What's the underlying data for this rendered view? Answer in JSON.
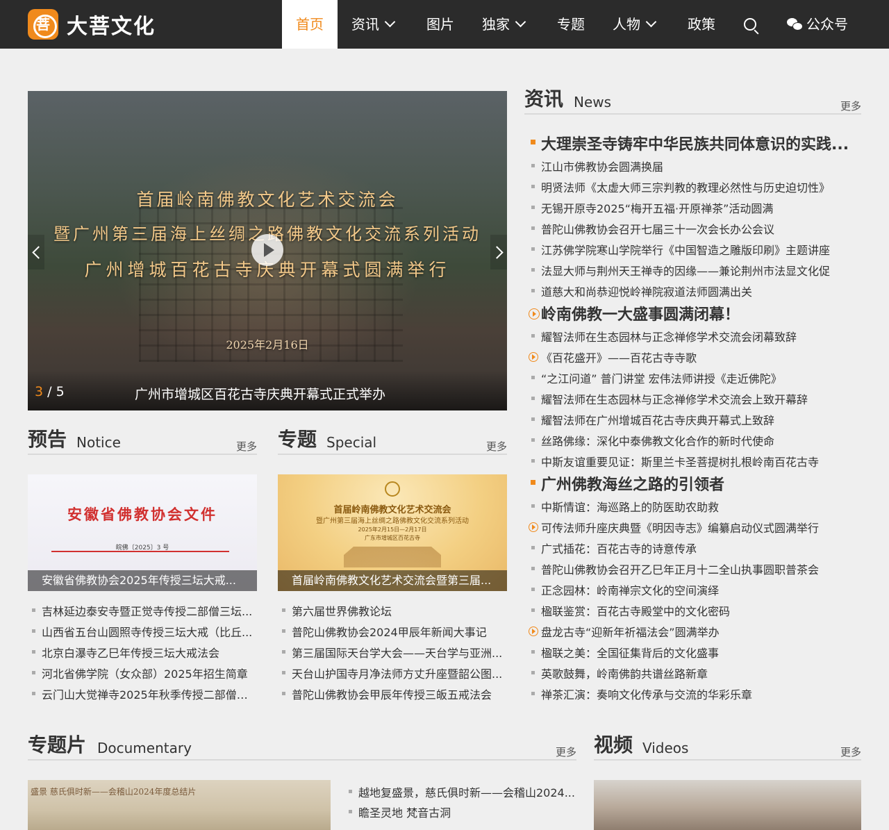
{
  "brand": {
    "logo_glyph": "菩",
    "name": "大菩文化",
    "accent": "#f08a1c"
  },
  "nav": {
    "home": "首页",
    "news": "资讯",
    "photos": "图片",
    "exclusive": "独家",
    "topics": "专题",
    "people": "人物",
    "policy": "政策",
    "wechat": "公众号"
  },
  "slider": {
    "line1": "首届岭南佛教文化艺术交流会",
    "line2": "暨广州第三届海上丝绸之路佛教文化交流系列活动",
    "line3": "广州增城百花古寺庆典开幕式圆满举行",
    "date": "2025年2月16日",
    "current": "3",
    "separator": " / ",
    "total": "5",
    "caption": "广州市增城区百花古寺庆典开幕式正式举办"
  },
  "news": {
    "title_zh": "资讯",
    "title_en": "News",
    "more": "更多",
    "items": [
      "大理崇圣寺铸牢中华民族共同体意识的实践...",
      "江山市佛教协会圆满换届",
      "明贤法师《太虚大师三宗判教的教理必然性与历史迫切性》",
      "无锡开原寺2025“梅开五福·开原禅茶”活动圆满",
      "普陀山佛教协会召开七届三十一次会长办公会议",
      "江苏佛学院寒山学院举行《中国智造之雕版印刷》主题讲座",
      "法显大师与荆州天王禅寺的因缘——兼论荆州市法显文化促",
      "道慈大和尚恭迎悦岭禅院寂道法师圆满出关",
      "岭南佛教一大盛事圆满闭幕！",
      "耀智法师在生态园林与正念禅修学术交流会闭幕致辞",
      "《百花盛开》——百花古寺寺歌",
      "“之江问道” 普门讲堂 宏伟法师讲授《走近佛陀》",
      "耀智法师在生态园林与正念禅修学术交流会上致开幕辞",
      "耀智法师在广州增城百花古寺庆典开幕式上致辞",
      "丝路佛缘：深化中泰佛教文化合作的新时代使命",
      "中斯友谊重要见证：斯里兰卡圣菩提树扎根岭南百花古寺",
      "广州佛教海丝之路的引领者",
      "中斯情谊：海巡路上的防医助农助救",
      "可传法师升座庆典暨《明因寺志》编纂启动仪式圆满举行",
      "广式插花：百花古寺的诗意传承",
      "普陀山佛教协会召开乙巳年正月十二全山执事圆职普茶会",
      "正念园林：岭南禅宗文化的空间演绎",
      "楹联鉴赏：百花古寺殿堂中的文化密码",
      "盘龙古寺“迎新年祈福法会”圆满举办",
      "楹联之美：全国征集背后的文化盛事",
      "英歌鼓舞，岭南佛韵共谱丝路新章",
      "禅茶汇演：奏响文化传承与交流的华彩乐章"
    ]
  },
  "notice": {
    "title_zh": "预告",
    "title_en": "Notice",
    "more": "更多",
    "card_doc_title": "安徽省佛教协会文件",
    "card_doc_no": "皖佛〔2025〕3 号",
    "card_caption": "安徽省佛教协会2025年传授三坛大戒...",
    "items": [
      "吉林延边泰安寺暨正觉寺传授二部僧三坛...",
      "山西省五台山圆照寺传授三坛大戒（比丘...",
      "北京白瀑寺乙巳年传授三坛大戒法会",
      "河北省佛学院（女众部）2025年招生简章",
      "云门山大觉禅寺2025年秋季传授二部僧三..."
    ]
  },
  "special": {
    "title_zh": "专题",
    "title_en": "Special",
    "more": "更多",
    "card_line1": "首届岭南佛教文化艺术交流会",
    "card_line2": "暨广州第三届海上丝绸之路佛教文化交流系列活动",
    "card_line3": "2025年2月15日—2月17日",
    "card_line4": "广东市增城区百花古寺",
    "card_caption": "首届岭南佛教文化艺术交流会暨第三届...",
    "items": [
      "第六届世界佛教论坛",
      "普陀山佛教协会2024甲辰年新闻大事记",
      "第三届国际天台学大会——天台学与亚洲...",
      "天台山护国寺月净法师方丈升座暨韶公图...",
      "普陀山佛教协会甲辰年传授三皈五戒法会"
    ]
  },
  "documentary": {
    "title_zh": "专题片",
    "title_en": "Documentary",
    "more": "更多",
    "image_title": "盛景 慈氏俱时新——会稽山2024年度总结片",
    "items": [
      "越地复盛景，慈氏俱时新——会稽山2024...",
      "瞻圣灵地 梵音古洞"
    ]
  },
  "videos": {
    "title_zh": "视频",
    "title_en": "Videos",
    "more": "更多"
  }
}
